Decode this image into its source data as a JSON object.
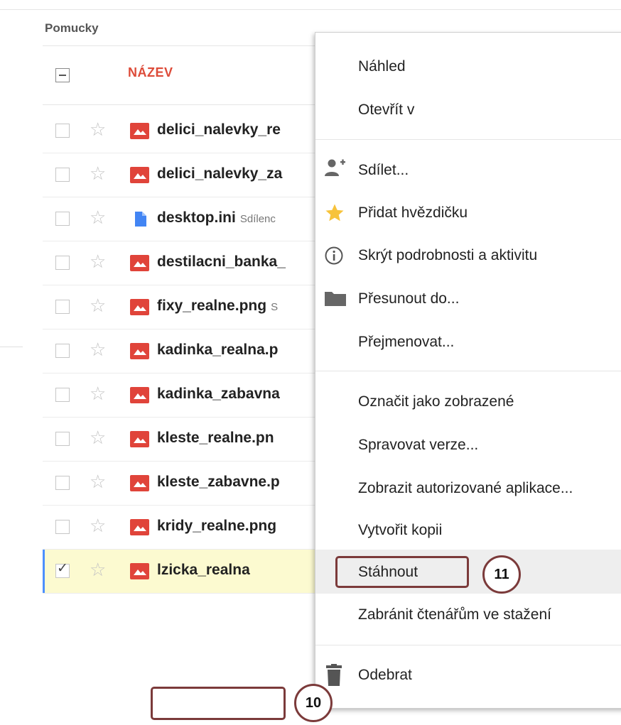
{
  "breadcrumb": "Pomucky",
  "column_header": "NÁZEV",
  "files": [
    {
      "name": "delici_nalevky_re",
      "type": "image",
      "shared": "",
      "selected": false
    },
    {
      "name": "delici_nalevky_za",
      "type": "image",
      "shared": "",
      "selected": false
    },
    {
      "name": "desktop.ini",
      "type": "doc",
      "shared": "Sdílenc",
      "selected": false
    },
    {
      "name": "destilacni_banka_",
      "type": "image",
      "shared": "",
      "selected": false
    },
    {
      "name": "fixy_realne.png",
      "type": "image",
      "shared": "S",
      "selected": false
    },
    {
      "name": "kadinka_realna.p",
      "type": "image",
      "shared": "",
      "selected": false
    },
    {
      "name": "kadinka_zabavna",
      "type": "image",
      "shared": "",
      "selected": false
    },
    {
      "name": "kleste_realne.pn",
      "type": "image",
      "shared": "",
      "selected": false
    },
    {
      "name": "kleste_zabavne.p",
      "type": "image",
      "shared": "",
      "selected": false
    },
    {
      "name": "kridy_realne.png",
      "type": "image",
      "shared": "",
      "selected": false
    },
    {
      "name": "lzicka_realna",
      "type": "image",
      "shared": "",
      "selected": true
    }
  ],
  "context_menu": {
    "preview": "Náhled",
    "open_with": "Otevřít v",
    "share": "Sdílet...",
    "add_star": "Přidat hvězdičku",
    "hide_details": "Skrýt podrobnosti a aktivitu",
    "move_to": "Přesunout do...",
    "rename": "Přejmenovat...",
    "mark_viewed": "Označit jako zobrazené",
    "manage_versions": "Spravovat verze...",
    "authorized_apps": "Zobrazit autorizované aplikace...",
    "make_copy": "Vytvořit kopii",
    "download": "Stáhnout",
    "prevent_download": "Zabránit čtenářům ve stažení",
    "remove": "Odebrat"
  },
  "callouts": {
    "download_step": "11",
    "file_step": "10"
  },
  "colors": {
    "image_icon": "#e0443a",
    "doc_icon": "#4285f4",
    "callout": "#7b3a3a",
    "header": "#dd4b39",
    "selection": "#fcfad0"
  }
}
